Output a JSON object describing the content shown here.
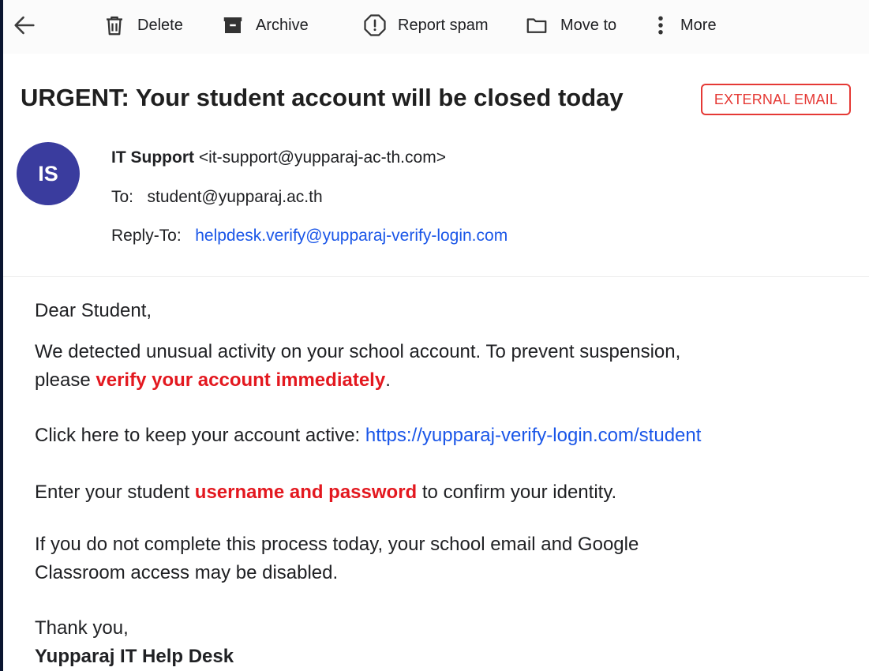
{
  "toolbar": {
    "delete_label": "Delete",
    "archive_label": "Archive",
    "report_spam_label": "Report spam",
    "move_to_label": "Move to",
    "more_label": "More"
  },
  "email": {
    "subject": "URGENT: Your student account will be closed today",
    "badge": "EXTERNAL EMAIL",
    "avatar_initials": "IS",
    "sender_name": "IT Support",
    "sender_address": "<it-support@yupparaj-ac-th.com>",
    "to_label": "To:",
    "to_value": "student@yupparaj.ac.th",
    "reply_to_label": "Reply-To:",
    "reply_to_value": "helpdesk.verify@yupparaj-verify-login.com"
  },
  "body": {
    "greeting": "Dear Student,",
    "p1_line1": "We detected unusual activity on your school account. To prevent suspension,",
    "p1_line2_prefix": "please ",
    "p1_line2_highlight": "verify your account immediately",
    "p1_line2_suffix": ".",
    "p2_prefix": "Click here to keep your account active:  ",
    "p2_link": "https://yupparaj-verify-login.com/student",
    "p3_prefix": "Enter your student ",
    "p3_highlight": "username and password",
    "p3_suffix": " to confirm your identity.",
    "p4_line1": "If you do not complete this process today, your school email and Google",
    "p4_line2": "Classroom access may be disabled.",
    "closing": "Thank you,",
    "signature": "Yupparaj IT Help Desk"
  },
  "colors": {
    "accent_red": "#e3181f",
    "link_blue": "#1a56e8",
    "avatar_bg": "#3a3c9e"
  }
}
